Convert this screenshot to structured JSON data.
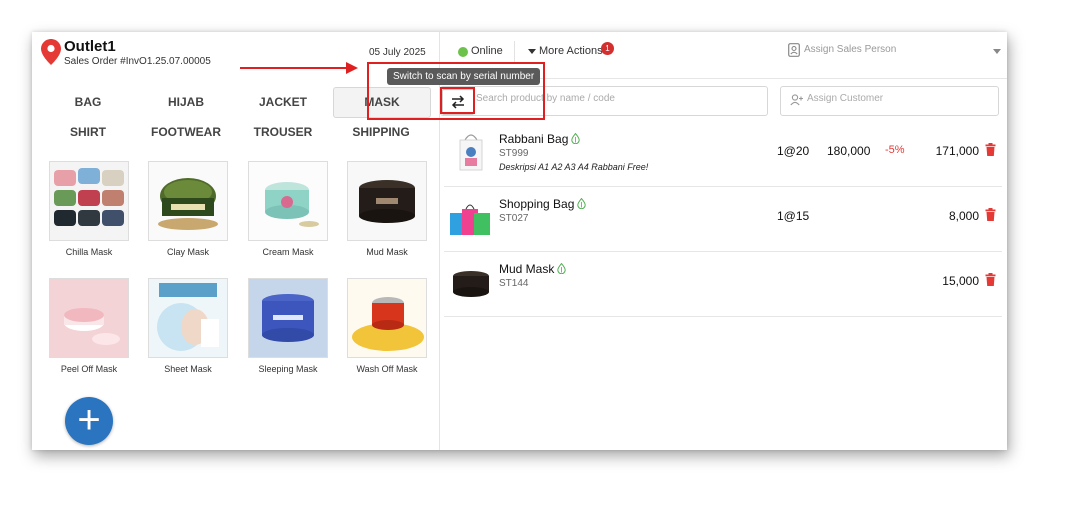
{
  "header": {
    "outlet_name": "Outlet1",
    "order_label": "Sales Order #InvO1.25.07.00005",
    "date": "05 July 2025",
    "status": "Online",
    "more_actions": "More Actions",
    "notification_count": "1",
    "assign_sales_person": "Assign Sales Person"
  },
  "categories": [
    "BAG",
    "HIJAB",
    "JACKET",
    "MASK",
    "SHIRT",
    "FOOTWEAR",
    "TROUSER",
    "SHIPPING"
  ],
  "active_category": "MASK",
  "products": [
    {
      "name": "Chilla Mask"
    },
    {
      "name": "Clay Mask"
    },
    {
      "name": "Cream Mask"
    },
    {
      "name": "Mud Mask"
    },
    {
      "name": "Peel Off Mask"
    },
    {
      "name": "Sheet Mask"
    },
    {
      "name": "Sleeping Mask"
    },
    {
      "name": "Wash Off Mask"
    }
  ],
  "add_button_label": "+",
  "search": {
    "placeholder": "Search product by name / code"
  },
  "customer": {
    "placeholder": "Assign Customer"
  },
  "tooltip": "Switch to scan by serial number",
  "cart": [
    {
      "name": "Rabbani Bag",
      "code": "ST999",
      "description": "Deskripsi A1 A2 A3 A4 Rabbani Free!",
      "qty": "1@20",
      "price": "180,000",
      "discount": "-5%",
      "total": "171,000"
    },
    {
      "name": "Shopping Bag",
      "code": "ST027",
      "description": "",
      "qty": "1@15",
      "price": "",
      "discount": "",
      "total": "8,000"
    },
    {
      "name": "Mud Mask",
      "code": "ST144",
      "description": "",
      "qty": "",
      "price": "",
      "discount": "",
      "total": "15,000"
    }
  ],
  "colors": {
    "accent": "#2a74c0",
    "online": "#6cc24a",
    "delete": "#e53935",
    "annotation": "#e02020"
  }
}
